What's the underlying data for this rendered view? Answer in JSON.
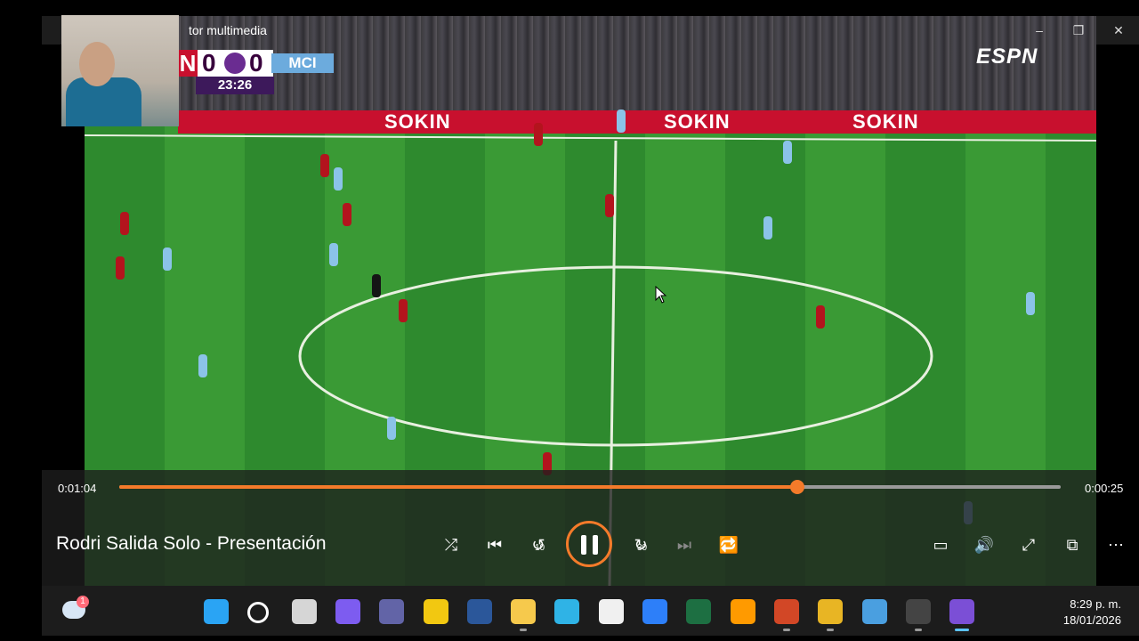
{
  "window": {
    "title": "tor multimedia",
    "minimize": "–",
    "restore": "❐",
    "close": "✕"
  },
  "scoreboard": {
    "home_abbr": "N",
    "home_score": "0",
    "away_score": "0",
    "away_abbr": "MCI",
    "clock": "23:26"
  },
  "broadcaster": "ESPN",
  "adboard": [
    "SOKIN",
    "SOKIN",
    "SOKIN"
  ],
  "player": {
    "elapsed": "0:01:04",
    "remaining": "0:00:25",
    "progress": 0.72,
    "media_title": "Rodri Salida Solo - Presentación",
    "controls": {
      "shuffle": "⤮",
      "previous": "⏮",
      "rewind": "↺",
      "rewind_label": "10",
      "forward": "↻",
      "forward_label": "30",
      "next": "⏭",
      "repeat": "🔁",
      "subtitles": "▭",
      "volume": "🔊",
      "fullscreen": "⤢",
      "miniplayer": "⧉",
      "more": "⋯"
    }
  },
  "taskbar": {
    "weather_badge": "1",
    "time": "8:29 p. m.",
    "date": "18/01/2026",
    "icons": [
      "start-icon",
      "search-icon",
      "task-view-icon",
      "copilot-icon",
      "teams-icon",
      "power-bi-icon",
      "word-icon",
      "file-explorer-icon",
      "edge-icon",
      "store-icon",
      "app-icon",
      "excel-icon",
      "illustrator-icon",
      "powerpoint-icon",
      "chrome-icon",
      "snipping-tool-icon",
      "obs-icon",
      "media-player-icon"
    ],
    "icon_colors": [
      "#2aa4f4",
      "#ffffff",
      "#d6d6d6",
      "#7d5cf0",
      "#6264a7",
      "#f2c811",
      "#2b579a",
      "#f6c94c",
      "#2fb3e6",
      "#f0f0f0",
      "#2d7ff9",
      "#1d6f42",
      "#ff9a00",
      "#d24726",
      "#e8b524",
      "#4a9fe0",
      "#444444",
      "#7b4fd6"
    ]
  },
  "colors": {
    "accent": "#f47b2a",
    "pitch": "#3a9a35",
    "home_kit": "#b3141d",
    "away_kit": "#8bc3e8"
  }
}
